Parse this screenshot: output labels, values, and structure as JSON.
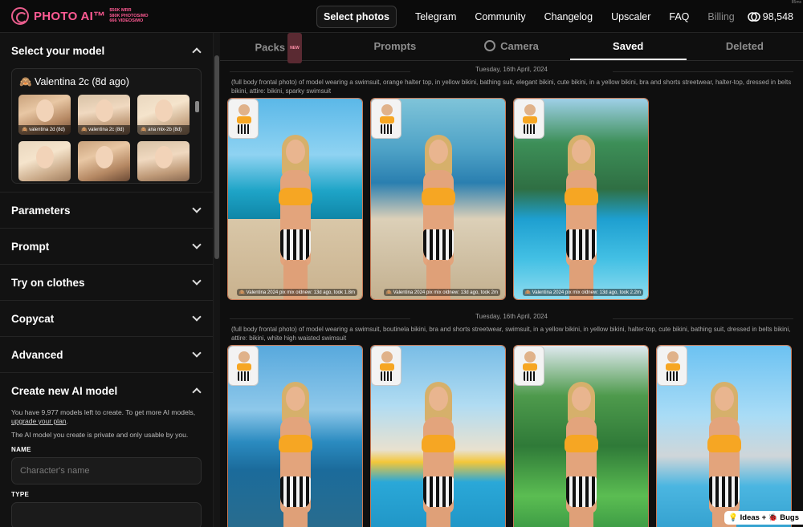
{
  "app": {
    "logo_text": "PHOTO AI™",
    "logo_stats": [
      "$56K MRR",
      "580K PHOTOS/MO",
      "666 VIDEOS/MO"
    ],
    "corner_text": "85ms"
  },
  "nav": {
    "select_photos": "Select photos",
    "telegram": "Telegram",
    "community": "Community",
    "changelog": "Changelog",
    "upscaler": "Upscaler",
    "faq": "FAQ",
    "billing": "Billing",
    "credits": "98,548"
  },
  "sidebar": {
    "select_model": {
      "title": "Select your model",
      "selected": "🙈 Valentina 2c (8d ago)",
      "thumbs": [
        {
          "label": "🙈 valentina 2d (8d)"
        },
        {
          "label": "🙈 valentina 2c (8d)"
        },
        {
          "label": "🙈 ana mix-2b (8d)"
        },
        {
          "label": ""
        },
        {
          "label": ""
        },
        {
          "label": ""
        }
      ]
    },
    "sections": {
      "parameters": "Parameters",
      "prompt": "Prompt",
      "try_on": "Try on clothes",
      "copycat": "Copycat",
      "advanced": "Advanced"
    },
    "create": {
      "title": "Create new AI model",
      "text1": "You have 9,977 models left to create. To get more AI models,",
      "link": "upgrade your plan",
      "text1_end": ".",
      "text2": "The AI model you create is private and only usable by you.",
      "name_label": "NAME",
      "name_placeholder": "Character's name",
      "type_label": "TYPE"
    }
  },
  "tabs": {
    "packs": "Packs",
    "packs_badge": "NEW",
    "prompts": "Prompts",
    "camera": "Camera",
    "saved": "Saved",
    "deleted": "Deleted"
  },
  "feed": [
    {
      "date": "Tuesday, 16th April, 2024",
      "prompt": "(full body frontal photo) of model wearing a swimsuit, orange halter top, in yellow bikini, bathing suit, elegant bikini, cute bikini, in a yellow bikini, bra and shorts streetwear, halter-top, dressed in belts bikini, attire: bikini, sparky swimsuit",
      "captions": [
        "🙈 Valentina 2024 pix mix oldnew: 13d ago, took 1.8m",
        "🙈 Valentina 2024 pix mix oldnew: 13d ago, took 2m",
        "🙈 Valentina 2024 pix mix oldnew: 13d ago, took 2.2m"
      ]
    },
    {
      "date": "Tuesday, 16th April, 2024",
      "prompt": "(full body frontal photo) of model wearing a swimsuit, boutinela bikini, bra and shorts streetwear, swimsuit, in a yellow bikini, in yellow bikini, halter-top, cute bikini, bathing suit, dressed in belts bikini, attire: bikini, white high waisted swimsuit"
    }
  ],
  "feedback": "💡 Ideas + 🐞 Bugs"
}
